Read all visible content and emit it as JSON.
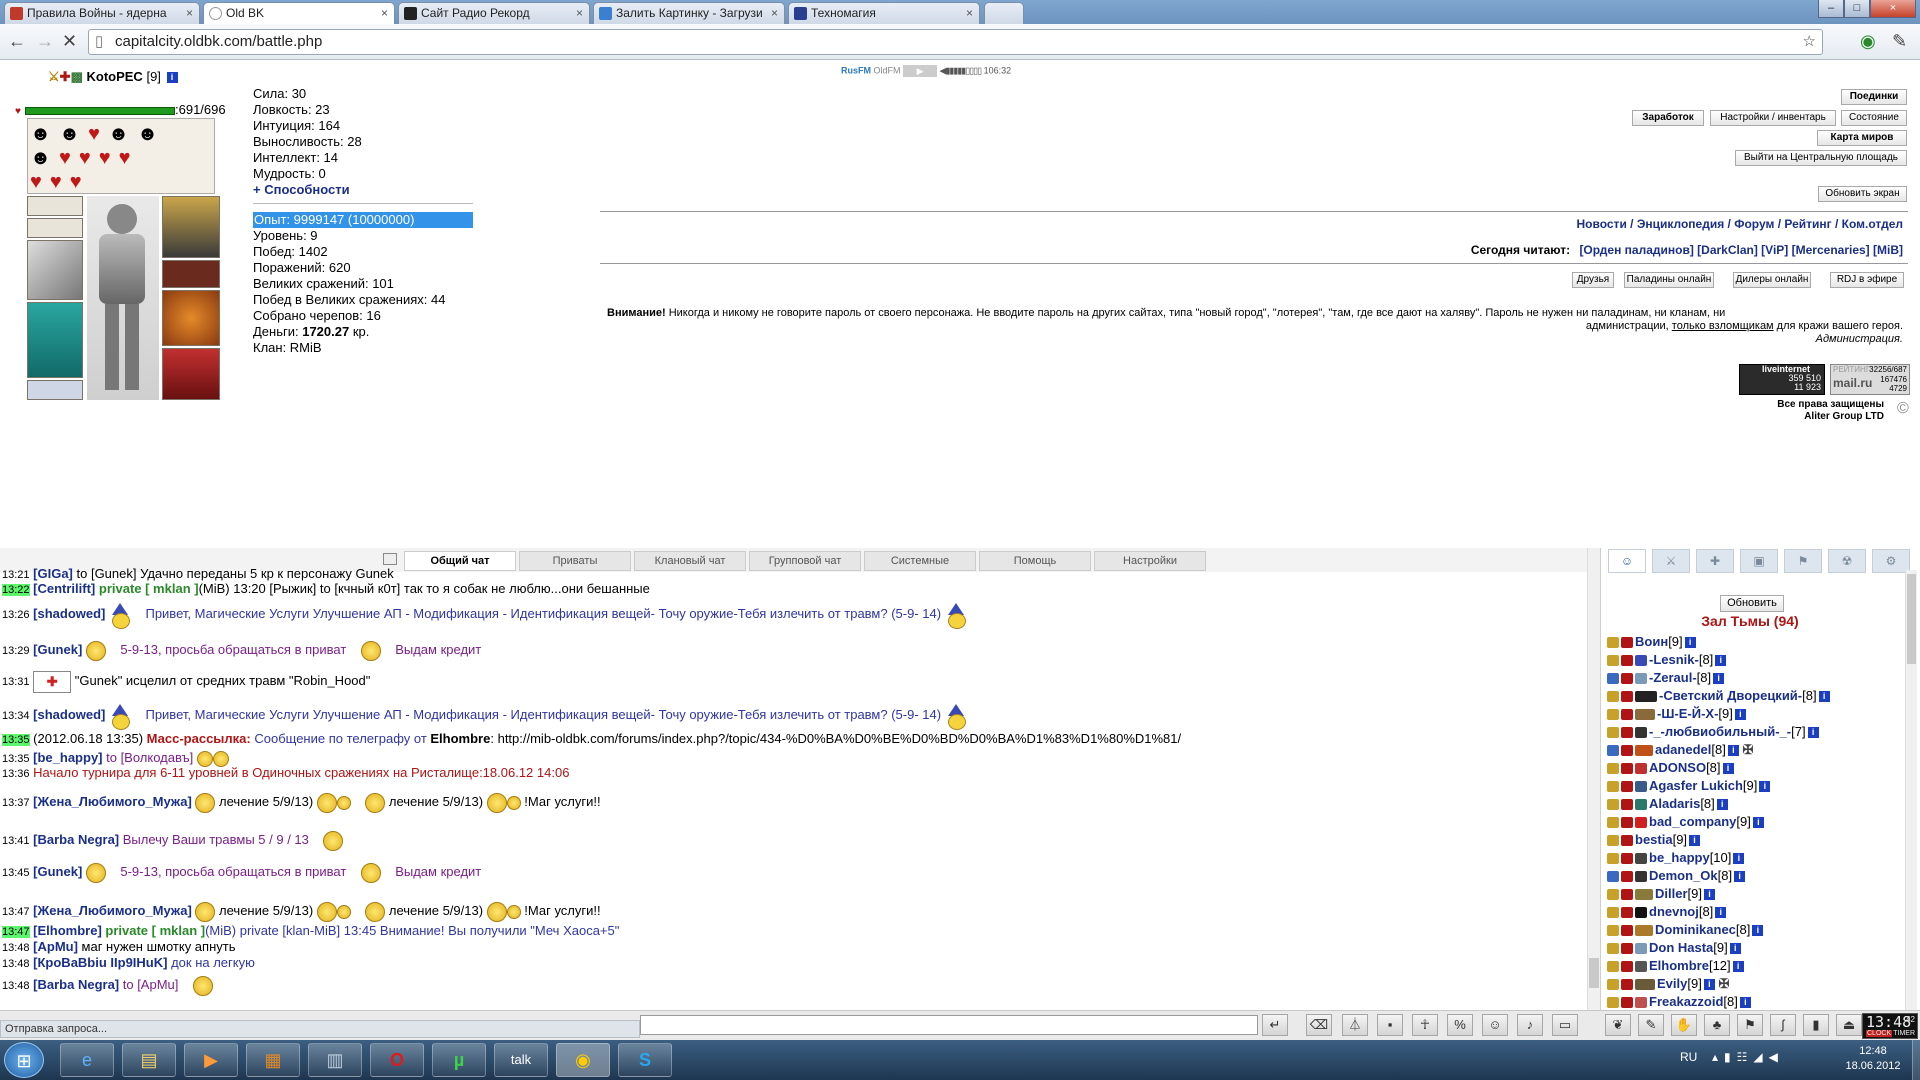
{
  "browser": {
    "tabs": [
      {
        "title": "Правила Войны - ядерна",
        "icon_color": "#c0392b"
      },
      {
        "title": "Old BK",
        "icon_color": "#ffffff"
      },
      {
        "title": "Сайт Радио Рекорд",
        "icon_color": "#222222"
      },
      {
        "title": "Залить Картинку - Загрузи",
        "icon_color": "#3a7fd0"
      },
      {
        "title": "Техномагия",
        "icon_color": "#2a3f8f"
      }
    ],
    "url": "capitalcity.oldbk.com/battle.php",
    "status": "Отправка запроса..."
  },
  "player": {
    "name": "KotoPEC",
    "level": "[9]",
    "hp": ":691/696",
    "stats": [
      "Сила: 30",
      "Ловкость: 23",
      "Интуиция: 164",
      "Выносливость: 28",
      "Интеллект: 14",
      "Мудрость: 0"
    ],
    "abilities_link": "+ Способности",
    "experience": "Опыт: 9999147 (10000000)",
    "details": [
      "Уровень: 9",
      "Побед: 1402",
      "Поражений: 620",
      "Великих сражений: 101",
      "Побед в Великих сражениях: 44",
      "Собрано черепов: 16"
    ],
    "money_label": "Деньги: ",
    "money_value": "1720.27",
    "money_unit": " кр.",
    "clan": "Клан: RMiB"
  },
  "radio": {
    "station1": "RusFM",
    "station2": "OldFM",
    "time": "106:32"
  },
  "top_buttons": {
    "duels": "Поединки",
    "earnings": "Заработок",
    "settings_inventory": "Настройки / инвентарь",
    "state": "Состояние",
    "world_map": "Карта миров",
    "exit_square": "Выйти на Центральную площадь",
    "refresh": "Обновить экран"
  },
  "news_links": "Новости / Энциклопедия / Форум / Рейтинг / Ком.отдел",
  "reading_today": {
    "label": "Сегодня читают:",
    "items": "[Орден паладинов]  [DarkClan]  [ViP]  [Mercenaries]  [MiB]"
  },
  "small_buttons": {
    "friends": "Друзья",
    "paladins": "Паладины онлайн",
    "dealers": "Дилеры онлайн",
    "rdj": "RDJ в эфире"
  },
  "warning": {
    "bold": "Внимание!",
    "text1": " Никогда и никому не говорите пароль от своего персонажа. Не вводите пароль на других сайтах, типа \"новый город\", \"лотерея\", \"там, где все дают на халяву\". Пароль не нужен ни паладинам, ни кланам, ни",
    "text2a": "администрации, ",
    "text2b": "только взломщикам",
    "text2c": " для кражи вашего героя.",
    "sign": "Администрация."
  },
  "counters": {
    "li_title": "liveinternet",
    "li_n1": "359 510",
    "li_n2": "11 923",
    "rating_label": "РЕЙТИНГ",
    "mail_label": "mail.ru",
    "r1": "32256/687",
    "r2": "167476",
    "r3": "4729",
    "rights1": "Все права защищены",
    "rights2": "Aliter Group LTD"
  },
  "chat_tabs": [
    "Общий чат",
    "Приваты",
    "Клановый чат",
    "Групповой чат",
    "Системные",
    "Помощь",
    "Настройки"
  ],
  "chat": {
    "l0": {
      "time": "13:21",
      "nick": "[GIGa]",
      "text": " to [Gunek] Удачно переданы 5 кр к персонажу Gunek"
    },
    "l1": {
      "time": "13:22",
      "nick": "[Centrilift]",
      "pm": " private [ mklan ]",
      "text": "(MiB) 13:20 [Рыжик] to [кчный к0т] так то я собак не люблю...они бешанные"
    },
    "l2": {
      "time": "13:26",
      "nick": "[shadowed]",
      "text": "Привет, Магические Услуги Улучшение АП - Модификация - Идентификация вещей- Точу оружие-Тебя излечить от травм? (5-9-  14)"
    },
    "l3": {
      "time": "13:29",
      "nick": "[Gunek]",
      "text1": "5-9-13, просьба обращаться в приват",
      "text2": "Выдам кредит"
    },
    "l4": {
      "time": "13:31",
      "text": "\"Gunek\" исцелил от средних травм \"Robin_Hood\""
    },
    "l5": {
      "time": "13:34",
      "nick": "[shadowed]",
      "text": "Привет, Магические Услуги Улучшение АП - Модификация - Идентификация вещей- Точу оружие-Тебя излечить от травм? (5-9-  14)"
    },
    "l6": {
      "time": "13:35",
      "date": "(2012.06.18 13:35)",
      "label": "Масс-рассылка:",
      "text": " Сообщение по телеграфу от ",
      "from": "Elhombre",
      "url": ": http://mib-oldbk.com/forums/index.php?/topic/434-%D0%BA%D0%BE%D0%BD%D0%BA%D1%83%D1%80%D1%81/"
    },
    "l7": {
      "time": "13:35",
      "nick": "[be_happy]",
      "text": " to [Волкодавъ]"
    },
    "l8": {
      "time": "13:36",
      "text": "Начало турнира для 6-11 уровней в Одиночных сражениях на Ристалище:18.06.12 14:06"
    },
    "l9": {
      "time": "13:37",
      "nick": "[Жена_Любимого_Мужа]",
      "t1": " лечение 5/9/13)",
      "t2": " лечение 5/9/13)",
      "t3": " !Маг услуги!!"
    },
    "l10": {
      "time": "13:41",
      "nick": "[Barba Negra]",
      "text": " Вылечу Ваши травмы 5 / 9 / 13"
    },
    "l11": {
      "time": "13:45",
      "nick": "[Gunek]",
      "text1": "5-9-13, просьба обращаться в приват",
      "text2": "Выдам кредит"
    },
    "l12": {
      "time": "13:47",
      "nick": "[Жена_Любимого_Мужа]",
      "t1": " лечение 5/9/13)",
      "t2": " лечение 5/9/13)",
      "t3": " !Маг услуги!!"
    },
    "l13": {
      "time": "13:47",
      "nick": "[Elhombre]",
      "pm": " private [ mklan ]",
      "text": "(MiB) private [klan-MiB] 13:45 Внимание! Вы получили \"Меч Хаоса+5\""
    },
    "l14": {
      "time": "13:48",
      "nick": "[ApMu]",
      "text": " маг нужен шмотку апнуть"
    },
    "l15": {
      "time": "13:48",
      "nick": "[КроВаВbiu IIp9IHuK]",
      "text": " док на легкую"
    },
    "l16": {
      "time": "13:48",
      "nick": "[Barba Negra]",
      "text": " to [ApMu]"
    }
  },
  "users_panel": {
    "refresh": "Обновить",
    "room": "Зал Тьмы (94)",
    "users": [
      {
        "name": "Воин",
        "lvl": "[9]"
      },
      {
        "name": "-Lesnik-",
        "lvl": "[8]"
      },
      {
        "name": "-Zeraul-",
        "lvl": "[8]"
      },
      {
        "name": "-Светский Дворецкий-",
        "lvl": "[8]"
      },
      {
        "name": "-Ш-Е-Й-Х-",
        "lvl": "[9]"
      },
      {
        "name": "-_-любвиобильный-_-",
        "lvl": "[7]"
      },
      {
        "name": "adanedel",
        "lvl": "[8]"
      },
      {
        "name": "ADONSO",
        "lvl": "[8]"
      },
      {
        "name": "Agasfer Lukich",
        "lvl": "[9]"
      },
      {
        "name": "Aladaris",
        "lvl": "[8]"
      },
      {
        "name": "bad_company",
        "lvl": "[9]"
      },
      {
        "name": "bestia",
        "lvl": "[9]"
      },
      {
        "name": "be_happy",
        "lvl": "[10]"
      },
      {
        "name": "Demon_Ok",
        "lvl": "[8]"
      },
      {
        "name": "Diller",
        "lvl": "[9]"
      },
      {
        "name": "dnevnoj",
        "lvl": "[8]"
      },
      {
        "name": "Dominikanec",
        "lvl": "[8]"
      },
      {
        "name": "Don Hasta",
        "lvl": "[9]"
      },
      {
        "name": "Elhombre",
        "lvl": "[12]"
      },
      {
        "name": "Evily",
        "lvl": "[9]"
      },
      {
        "name": "Freakazzoid",
        "lvl": "[8]"
      }
    ]
  },
  "bottom": {
    "clock": "13:48",
    "clock_sec": "42",
    "timer_label1": "CLOCK",
    "timer_label2": "TIMER"
  },
  "taskbar": {
    "lang": "RU",
    "time": "12:48",
    "date": "18.06.2012"
  }
}
